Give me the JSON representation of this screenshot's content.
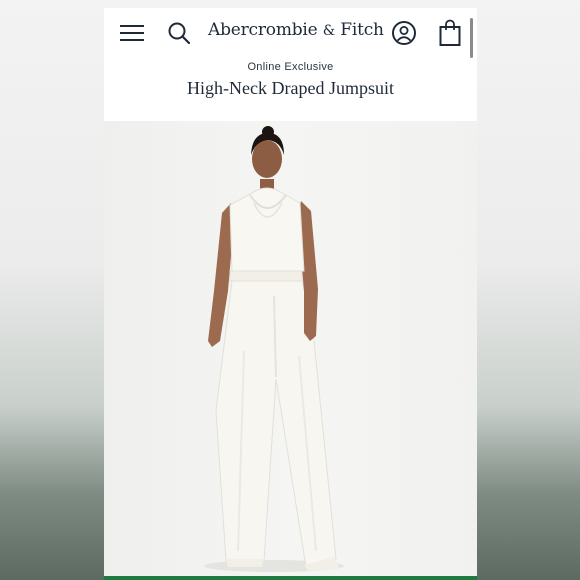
{
  "header": {
    "brand_part1": "Abercrombie",
    "brand_amp": "&",
    "brand_part2": "Fitch",
    "icons": [
      "menu-icon",
      "search-icon",
      "account-icon",
      "shopping-bag-icon"
    ]
  },
  "product": {
    "badge": "Online Exclusive",
    "title": "High-Neck Draped Jumpsuit",
    "image": "model wearing white high-neck draped jumpsuit"
  },
  "colors": {
    "text": "#1f2a38",
    "accent": "#1e7a3e",
    "garment": "#f7f6f1"
  }
}
